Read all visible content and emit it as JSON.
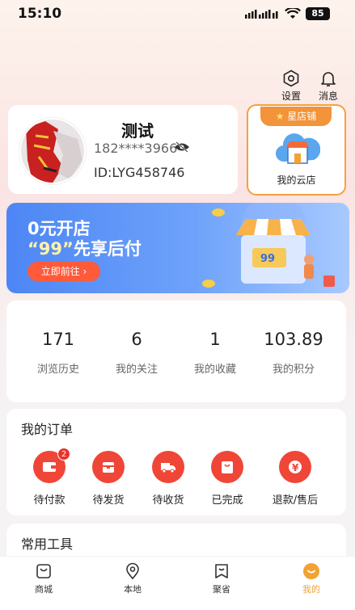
{
  "status_bar": {
    "time": "15:10",
    "battery": "85"
  },
  "header": {
    "settings_label": "设置",
    "messages_label": "消息"
  },
  "profile": {
    "name": "测试",
    "phone": "182****3966",
    "id": "ID:LYG458746"
  },
  "store": {
    "tag": "星店铺",
    "label": "我的云店"
  },
  "banner": {
    "line1": "0元开店",
    "line2_quote": "“99”",
    "line2_text": "先享后付",
    "button": "立即前往 ›"
  },
  "stats": [
    {
      "value": "171",
      "label": "浏览历史"
    },
    {
      "value": "6",
      "label": "我的关注"
    },
    {
      "value": "1",
      "label": "我的收藏"
    },
    {
      "value": "103.89",
      "label": "我的积分"
    }
  ],
  "orders": {
    "title": "我的订单",
    "items": [
      {
        "label": "待付款",
        "icon": "wallet-icon",
        "badge": "2"
      },
      {
        "label": "待发货",
        "icon": "package-icon"
      },
      {
        "label": "待收货",
        "icon": "truck-icon"
      },
      {
        "label": "已完成",
        "icon": "bag-icon"
      },
      {
        "label": "退款/售后",
        "icon": "yen-icon"
      }
    ]
  },
  "tools": {
    "title": "常用工具"
  },
  "tabbar": {
    "items": [
      {
        "label": "商城",
        "icon": "shop-bag-icon"
      },
      {
        "label": "本地",
        "icon": "location-pin-icon"
      },
      {
        "label": "聚省",
        "icon": "bookmark-icon"
      },
      {
        "label": "我的",
        "icon": "smile-face-icon",
        "active": true
      }
    ]
  },
  "colors": {
    "accent": "#f2a233",
    "order_red": "#f04638",
    "banner_blue": "#4d86f5"
  }
}
